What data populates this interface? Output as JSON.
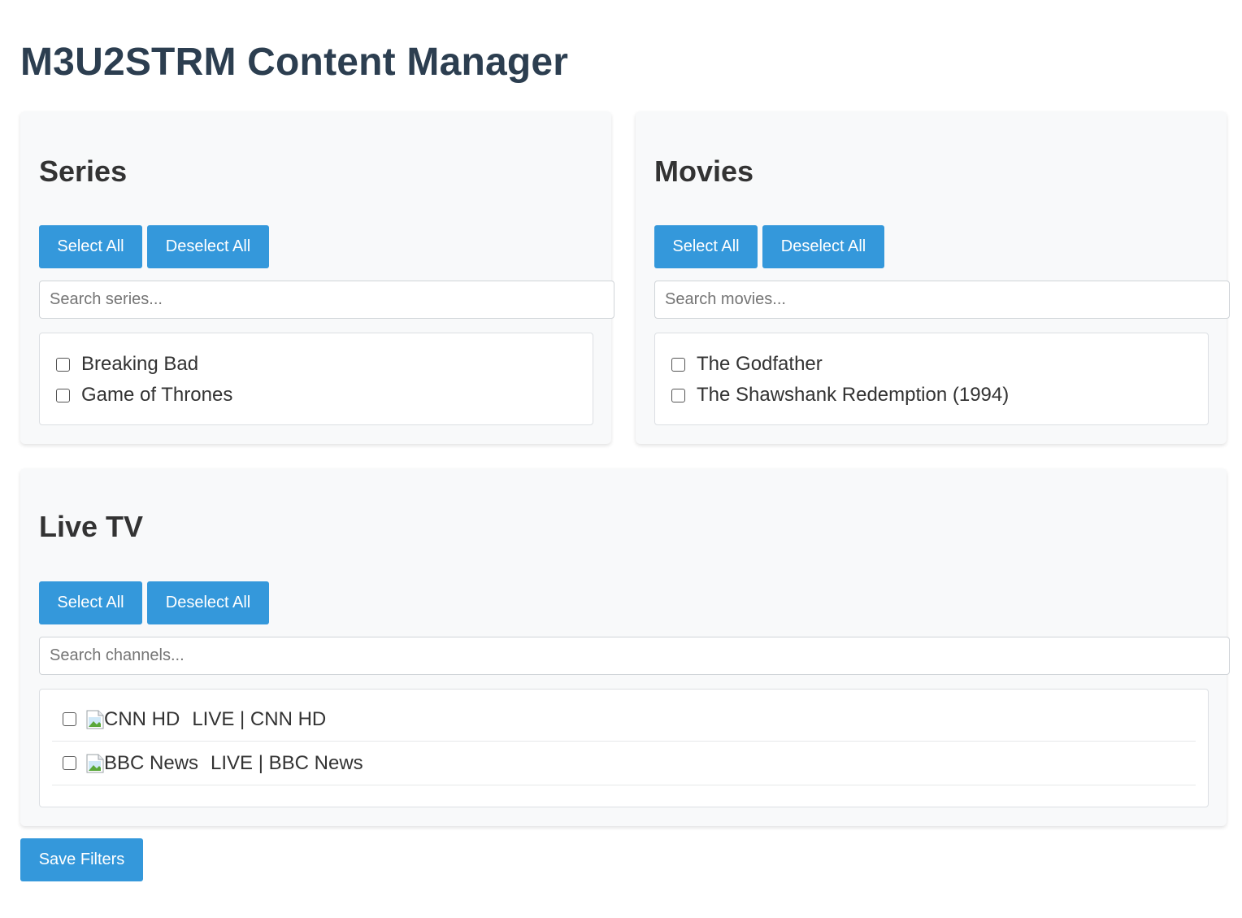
{
  "app": {
    "title": "M3U2STRM Content Manager"
  },
  "colors": {
    "accent": "#3498db",
    "title": "#2c3e50",
    "panel_bg": "#f8f9fa"
  },
  "series": {
    "title": "Series",
    "select_all": "Select All",
    "deselect_all": "Deselect All",
    "search_placeholder": "Search series...",
    "items": [
      {
        "label": "Breaking Bad",
        "checked": false
      },
      {
        "label": "Game of Thrones",
        "checked": false
      }
    ]
  },
  "movies": {
    "title": "Movies",
    "select_all": "Select All",
    "deselect_all": "Deselect All",
    "search_placeholder": "Search movies...",
    "items": [
      {
        "label": "The Godfather",
        "checked": false
      },
      {
        "label": "The Shawshank Redemption (1994)",
        "checked": false
      }
    ]
  },
  "live_tv": {
    "title": "Live TV",
    "select_all": "Select All",
    "deselect_all": "Deselect All",
    "search_placeholder": "Search channels...",
    "channels": [
      {
        "logo_alt": "CNN HD",
        "label": "LIVE | CNN HD",
        "checked": false,
        "logo_icon": "broken-image-icon"
      },
      {
        "logo_alt": "BBC News",
        "label": "LIVE | BBC News",
        "checked": false,
        "logo_icon": "broken-image-icon"
      }
    ]
  },
  "save_button": "Save Filters"
}
